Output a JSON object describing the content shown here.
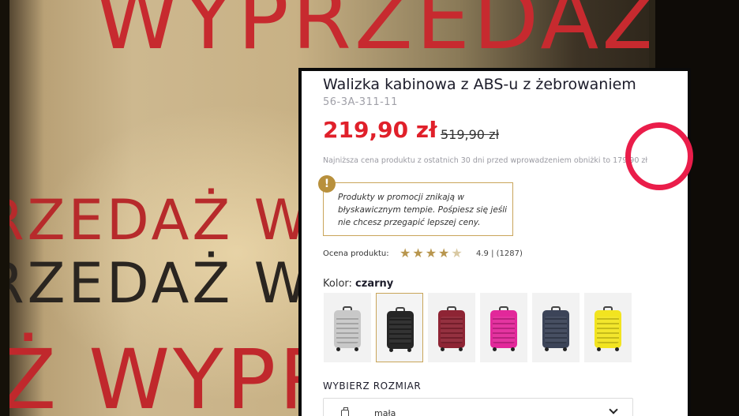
{
  "background": {
    "words": [
      "WYPRZEDAŻ",
      "RZEDAŻ WY",
      "RZEDAŻ WY",
      "Ż WYPR"
    ]
  },
  "product": {
    "title": "Walizka kabinowa z ABS-u z żebrowaniem",
    "sku": "56-3A-311-11",
    "price": "219,90 zł",
    "old_price": "519,90 zł",
    "lowest_price_note": "Najniższa cena produktu z ostatnich 30 dni przed wprowadzeniem obniżki to 179,90 zł",
    "promo": {
      "icon": "exclamation-icon",
      "text": "Produkty w promocji znikają w błyskawicznym tempie. Pośpiesz się jeśli nie chcesz przegapić lepszej ceny."
    },
    "rating": {
      "label": "Ocena produktu:",
      "value_text": "4.9 | (1287)",
      "stars": 4.5
    },
    "color": {
      "label": "Kolor:",
      "selected": "czarny",
      "swatches": [
        "#c8c8c8",
        "#262626",
        "#8e2434",
        "#e2289a",
        "#3c4458",
        "#f2e420"
      ]
    },
    "size": {
      "label": "WYBIERZ ROZMIAR",
      "selected": "mała"
    }
  },
  "colors": {
    "price_red": "#e0202a",
    "accent_gold": "#c9a55a",
    "highlight_circle": "#ea1d4a"
  }
}
